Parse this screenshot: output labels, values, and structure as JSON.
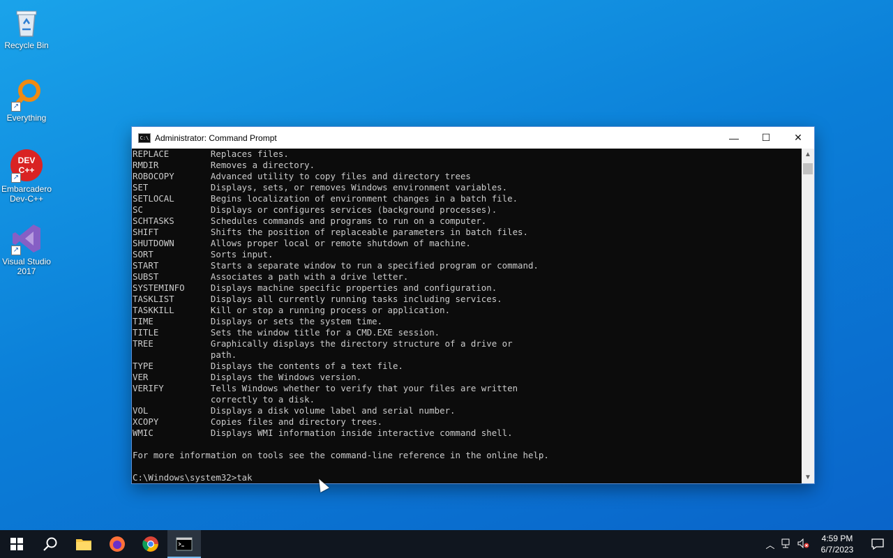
{
  "desktop": {
    "icons": [
      {
        "label": "Recycle Bin"
      },
      {
        "label": "Everything"
      },
      {
        "label": "Embarcadero Dev-C++",
        "logo_text": "DEV C++"
      },
      {
        "label": "Visual Studio 2017"
      }
    ]
  },
  "window": {
    "title": "Administrator:  Command Prompt",
    "app_icon_text": "C:\\",
    "controls": {
      "minimize": "—",
      "maximize": "☐",
      "close": "✕"
    },
    "console_lines": [
      "REPLACE        Replaces files.",
      "RMDIR          Removes a directory.",
      "ROBOCOPY       Advanced utility to copy files and directory trees",
      "SET            Displays, sets, or removes Windows environment variables.",
      "SETLOCAL       Begins localization of environment changes in a batch file.",
      "SC             Displays or configures services (background processes).",
      "SCHTASKS       Schedules commands and programs to run on a computer.",
      "SHIFT          Shifts the position of replaceable parameters in batch files.",
      "SHUTDOWN       Allows proper local or remote shutdown of machine.",
      "SORT           Sorts input.",
      "START          Starts a separate window to run a specified program or command.",
      "SUBST          Associates a path with a drive letter.",
      "SYSTEMINFO     Displays machine specific properties and configuration.",
      "TASKLIST       Displays all currently running tasks including services.",
      "TASKKILL       Kill or stop a running process or application.",
      "TIME           Displays or sets the system time.",
      "TITLE          Sets the window title for a CMD.EXE session.",
      "TREE           Graphically displays the directory structure of a drive or",
      "               path.",
      "TYPE           Displays the contents of a text file.",
      "VER            Displays the Windows version.",
      "VERIFY         Tells Windows whether to verify that your files are written",
      "               correctly to a disk.",
      "VOL            Displays a disk volume label and serial number.",
      "XCOPY          Copies files and directory trees.",
      "WMIC           Displays WMI information inside interactive command shell.",
      "",
      "For more information on tools see the command-line reference in the online help.",
      "",
      "C:\\Windows\\system32>tak"
    ]
  },
  "taskbar": {
    "tray_icons": [
      "chevron-up-icon",
      "network-icon",
      "volume-muted-icon"
    ],
    "time": "4:59 PM",
    "date": "6/7/2023"
  },
  "colors": {
    "desktop_blue": "#0b7fd8",
    "taskbar": "#10161f",
    "console_bg": "#0c0c0c",
    "console_text": "#cccccc"
  }
}
